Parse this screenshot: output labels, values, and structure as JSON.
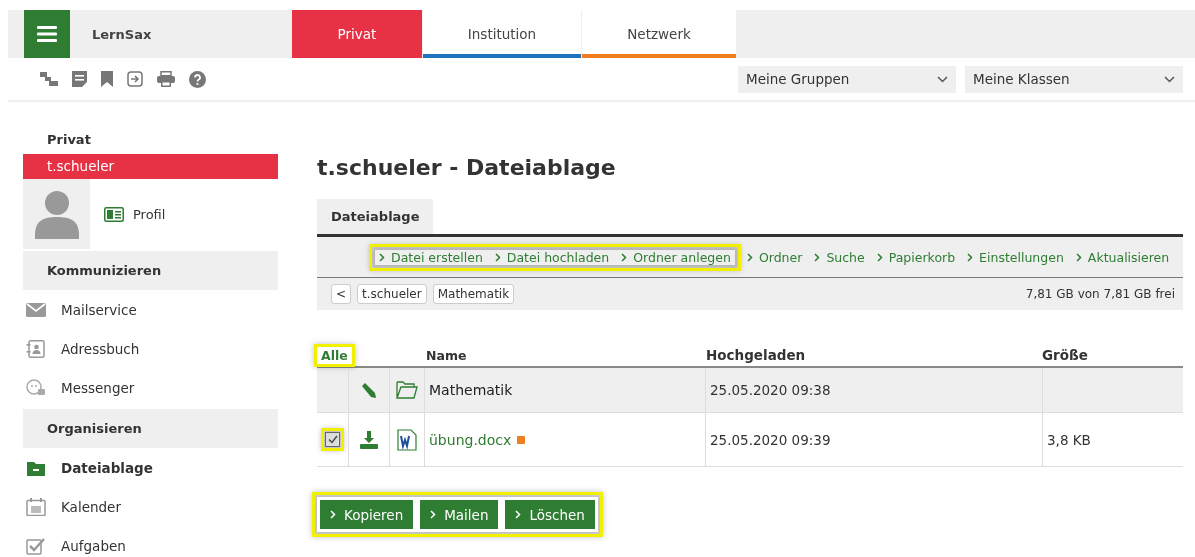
{
  "header": {
    "brand": "LernSax",
    "tabs": [
      {
        "label": "Privat",
        "selected": true,
        "color": "#e63244"
      },
      {
        "label": "Institution",
        "selected": false,
        "color": "#1e73be"
      },
      {
        "label": "Netzwerk",
        "selected": false,
        "color": "#ef7d22"
      }
    ],
    "selects": [
      {
        "value": "Meine Gruppen"
      },
      {
        "value": "Meine Klassen"
      }
    ]
  },
  "sidebar": {
    "section_title": "Privat",
    "user": {
      "name": "t.schueler",
      "selected": true
    },
    "profile_link": "Profil",
    "groups": [
      {
        "heading": "Kommunizieren",
        "items": [
          {
            "label": "Mailservice",
            "selected": false
          },
          {
            "label": "Adressbuch",
            "selected": false
          },
          {
            "label": "Messenger",
            "selected": false
          }
        ]
      },
      {
        "heading": "Organisieren",
        "items": [
          {
            "label": "Dateiablage",
            "selected": true
          },
          {
            "label": "Kalender",
            "selected": false
          },
          {
            "label": "Aufgaben",
            "selected": false
          }
        ]
      }
    ]
  },
  "main": {
    "title": "t.schueler - Dateiablage",
    "panel_tab": "Dateiablage",
    "action_groups": [
      {
        "highlighted": true,
        "actions": [
          "Datei erstellen",
          "Datei hochladen",
          "Ordner anlegen"
        ]
      },
      {
        "highlighted": false,
        "actions": [
          "Ordner",
          "Suche",
          "Papierkorb",
          "Einstellungen",
          "Aktualisieren"
        ]
      }
    ],
    "breadcrumb": {
      "back": "<",
      "crumbs": [
        "t.schueler",
        "Mathematik"
      ],
      "quota": "7,81 GB von 7,81 GB frei"
    },
    "table": {
      "select_all": {
        "label": "Alle",
        "highlighted": true
      },
      "columns": [
        "Name",
        "Hochgeladen",
        "Größe"
      ],
      "rows": [
        {
          "kind": "folder",
          "name": "Mathematik",
          "uploaded": "25.05.2020 09:38"
        },
        {
          "kind": "file",
          "name": "übung.docx",
          "uploaded": "25.05.2020 09:39",
          "size": "3,8 KB",
          "checked": true,
          "highlighted": true,
          "new": true
        }
      ]
    },
    "buttons": {
      "highlighted": true,
      "labels": [
        "Kopieren",
        "Mailen",
        "Löschen"
      ]
    }
  }
}
